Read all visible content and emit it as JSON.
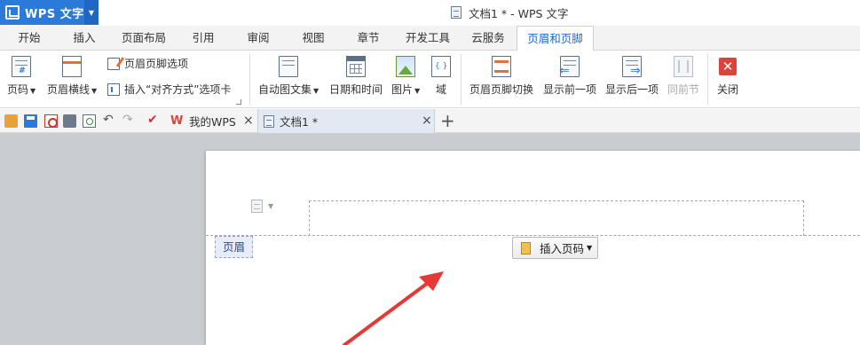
{
  "app": {
    "name": "WPS 文字",
    "window_title": "文档1 * - WPS 文字"
  },
  "ribbon_tabs": [
    {
      "label": "开始"
    },
    {
      "label": "插入"
    },
    {
      "label": "页面布局"
    },
    {
      "label": "引用"
    },
    {
      "label": "审阅"
    },
    {
      "label": "视图"
    },
    {
      "label": "章节"
    },
    {
      "label": "开发工具"
    },
    {
      "label": "云服务"
    },
    {
      "label": "页眉和页脚",
      "active": true
    }
  ],
  "ribbon": {
    "page_number": "页码",
    "header_line": "页眉横线",
    "header_footer_options": "页眉页脚选项",
    "insert_align_tab": "插入“对齐方式”选项卡",
    "auto_text": "自动图文集",
    "date_time": "日期和时间",
    "picture": "图片",
    "field": "域",
    "switch_header_footer": "页眉页脚切换",
    "show_previous": "显示前一项",
    "show_next": "显示后一项",
    "same_as_previous": "同前节",
    "close": "关闭"
  },
  "doc_tabs": [
    {
      "label": "我的WPS"
    },
    {
      "label": "文档1 *",
      "active": true
    }
  ],
  "document": {
    "header_label": "页眉",
    "insert_page_number": "插入页码"
  },
  "colors": {
    "accent": "#2b79d8",
    "close_red": "#d9453b",
    "annotation_arrow": "#e53935"
  },
  "icons": {
    "app": "wps-writer-logo-icon",
    "open": "folder-open-icon",
    "save": "save-icon",
    "pdf": "export-pdf-icon",
    "print": "print-icon",
    "preview": "print-preview-icon",
    "undo": "undo-icon",
    "redo": "redo-icon",
    "add_tab": "plus-icon"
  }
}
